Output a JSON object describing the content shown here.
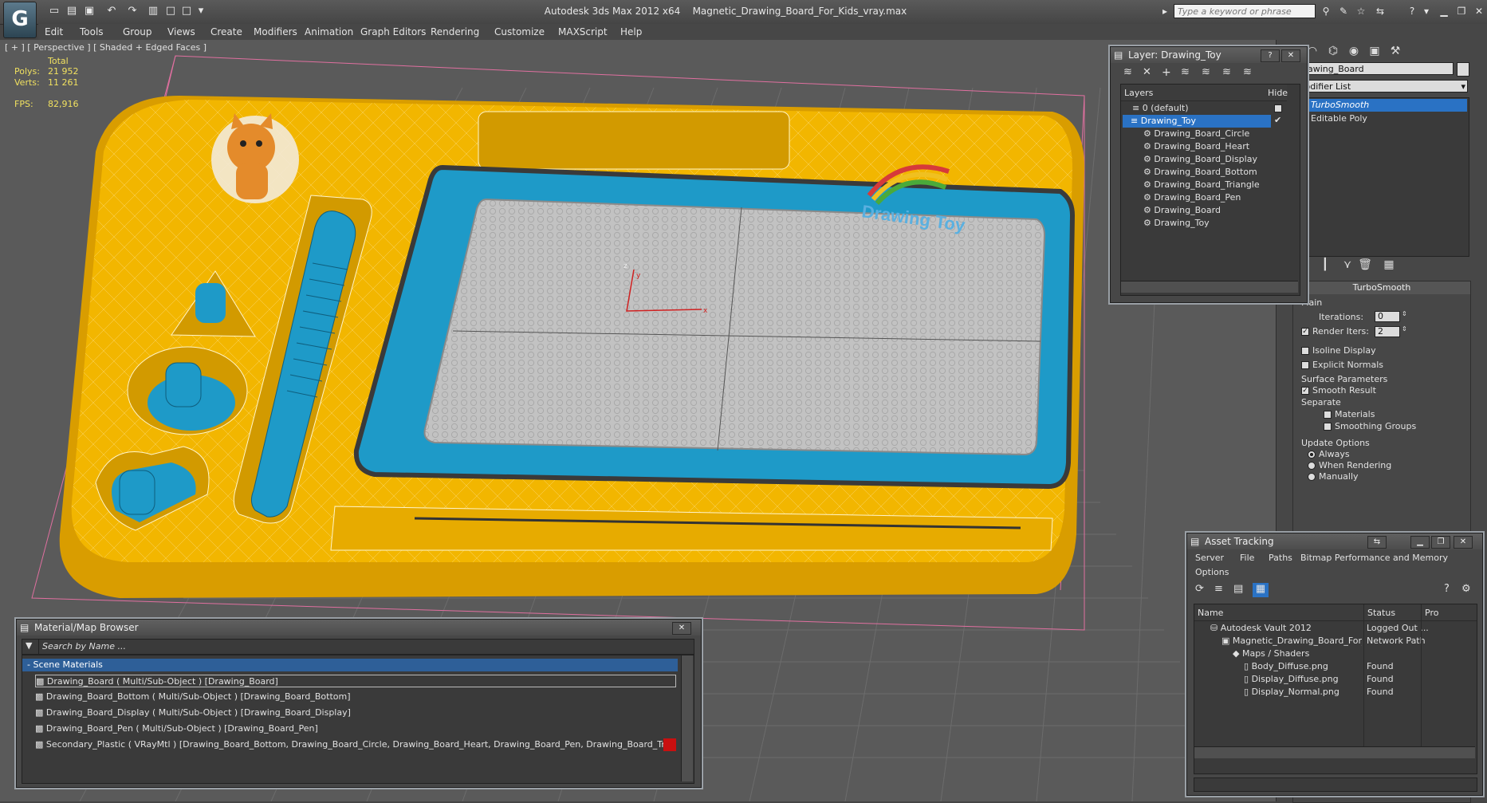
{
  "app": {
    "title": "Autodesk 3ds Max  2012 x64",
    "file": "Magnetic_Drawing_Board_For_Kids_vray.max",
    "search_placeholder": "Type a keyword or phrase",
    "logo": "3ds-max-logo"
  },
  "menu": [
    "Edit",
    "Tools",
    "Group",
    "Views",
    "Create",
    "Modifiers",
    "Animation",
    "Graph Editors",
    "Rendering",
    "Customize",
    "MAXScript",
    "Help"
  ],
  "viewport": {
    "label": "[ + ] [ Perspective ] [ Shaded + Edged Faces ]",
    "stats": {
      "total_label": "Total",
      "polys_label": "Polys:",
      "polys": "21 952",
      "verts_label": "Verts:",
      "verts": "11 261",
      "fps_label": "FPS:",
      "fps": "82,916"
    },
    "gizmo": {
      "z": "z",
      "y": "y",
      "x": "x"
    },
    "decal_text": "Drawing Toy"
  },
  "command_panel": {
    "object_name": "Drawing_Board",
    "modifier_list_label": "Modifier List",
    "stack": [
      {
        "label": "TurboSmooth",
        "selected": true
      },
      {
        "label": "Editable Poly",
        "selected": false
      }
    ],
    "turbosmooth": {
      "title": "TurboSmooth",
      "main_label": "Main",
      "iterations_label": "Iterations:",
      "iterations": "0",
      "render_iters_label": "Render Iters:",
      "render_iters": "2",
      "render_iters_checked": true,
      "isoline_label": "Isoline Display",
      "explicit_normals_label": "Explicit Normals",
      "surface_label": "Surface Parameters",
      "smooth_result_label": "Smooth Result",
      "smooth_result_checked": true,
      "separate_label": "Separate",
      "materials_label": "Materials",
      "smoothing_groups_label": "Smoothing Groups",
      "update_label": "Update Options",
      "always_label": "Always",
      "when_rendering_label": "When Rendering",
      "manually_label": "Manually",
      "update_selected": "Always"
    }
  },
  "layer_window": {
    "title": "Layer: Drawing_Toy",
    "help": "?",
    "col_layers": "Layers",
    "col_hide": "Hide",
    "rows": [
      {
        "label": "0 (default)",
        "level": 1,
        "kind": "layer"
      },
      {
        "label": "Drawing_Toy",
        "level": 1,
        "kind": "layer",
        "selected": true
      },
      {
        "label": "Drawing_Board_Circle",
        "level": 2,
        "kind": "object"
      },
      {
        "label": "Drawing_Board_Heart",
        "level": 2,
        "kind": "object"
      },
      {
        "label": "Drawing_Board_Display",
        "level": 2,
        "kind": "object"
      },
      {
        "label": "Drawing_Board_Bottom",
        "level": 2,
        "kind": "object"
      },
      {
        "label": "Drawing_Board_Triangle",
        "level": 2,
        "kind": "object"
      },
      {
        "label": "Drawing_Board_Pen",
        "level": 2,
        "kind": "object"
      },
      {
        "label": "Drawing_Board",
        "level": 2,
        "kind": "object"
      },
      {
        "label": "Drawing_Toy",
        "level": 2,
        "kind": "object"
      }
    ]
  },
  "material_browser": {
    "title": "Material/Map Browser",
    "search_placeholder": "Search by Name ...",
    "group_label": "- Scene Materials",
    "items": [
      "Drawing_Board  ( Multi/Sub-Object ) [Drawing_Board]",
      "Drawing_Board_Bottom  ( Multi/Sub-Object ) [Drawing_Board_Bottom]",
      "Drawing_Board_Display  ( Multi/Sub-Object ) [Drawing_Board_Display]",
      "Drawing_Board_Pen  ( Multi/Sub-Object ) [Drawing_Board_Pen]",
      "Secondary_Plastic  ( VRayMtl ) [Drawing_Board_Bottom, Drawing_Board_Circle, Drawing_Board_Heart, Drawing_Board_Pen, Drawing_Board_Triangle]"
    ]
  },
  "asset_tracking": {
    "title": "Asset Tracking",
    "menu": [
      "Server",
      "File",
      "Paths",
      "Bitmap Performance and Memory",
      "Options"
    ],
    "col_name": "Name",
    "col_status": "Status",
    "col_pro": "Pro",
    "rows": [
      {
        "name": "Autodesk Vault 2012",
        "status": "Logged Out ...",
        "level": 1
      },
      {
        "name": "Magnetic_Drawing_Board_For_Ki...",
        "status": "Network Path",
        "level": 2
      },
      {
        "name": "Maps / Shaders",
        "status": "",
        "level": 3
      },
      {
        "name": "Body_Diffuse.png",
        "status": "Found",
        "level": 4
      },
      {
        "name": "Display_Diffuse.png",
        "status": "Found",
        "level": 4
      },
      {
        "name": "Display_Normal.png",
        "status": "Found",
        "level": 4
      }
    ]
  },
  "colors": {
    "board_yellow": "#f2b600",
    "board_blue": "#1e9ac8",
    "screen_gray": "#bdbdbd",
    "selection_blue": "#2a72c4",
    "viewport_bg": "#5a5a5a"
  }
}
